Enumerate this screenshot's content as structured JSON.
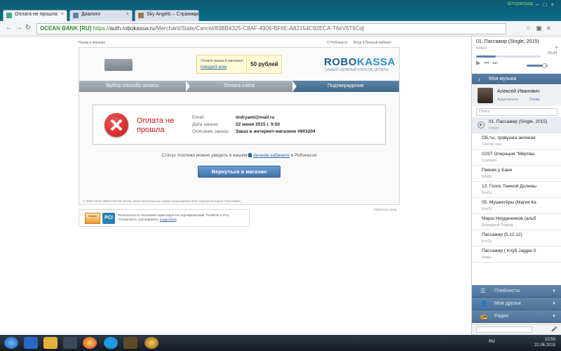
{
  "browser": {
    "tabs": [
      {
        "label": "Оплата не прошла"
      },
      {
        "label": "Диалоги"
      },
      {
        "label": "Sky Angels – Страница"
      }
    ],
    "top_brand": "Штормград",
    "ev_label": "OCEAN BANK [RU]",
    "url_scheme": "https://",
    "url_host": "auth.robokassa.ru",
    "url_path": "/Merchant/State/Cancel/83BB4325-C8AF-4906-BF6E-A82154C92ECA-T6eV5T6Cdj"
  },
  "page": {
    "back_link": "Назад в магазин",
    "about_link": "О Робокассе",
    "cabinet_link": "Вход в Личный кабинет",
    "order_label": "Оплата заказа в магазине",
    "shop_name": "tsengard-wow",
    "amount": "50 рублей",
    "logo_a": "ROBO",
    "logo_b": "KASSA",
    "logo_tagline": "САМЫЙ УДОБНЫЙ СПОСОБ ОПЛАТЫ",
    "steps": [
      "Выбор способа оплаты",
      "Оплата счета",
      "Подтверждение"
    ],
    "error_title": "Оплата не прошла",
    "info": {
      "email_label": "Email:",
      "email": "drdryaml@mail.ru",
      "date_label": "Дата заказа:",
      "date": "22 июня 2015 г. 9:50",
      "desc_label": "Описание заказа:",
      "desc": "Заказ в интернет-магазине #903204"
    },
    "status_pre": "Статус платежа можно увидеть в вашем",
    "status_link": "личном кабинете",
    "status_post": "в Робокассе.",
    "return_button": "Вернуться в магазин",
    "copyright": "© 2003-2015 ОКЕАН БАНК (ЗАО), неисключительные права пользования ЗАО «Центр Интернет Платежей»",
    "support_link": "Обратная связь",
    "badge_thawte": "thawte",
    "badge_pci": "PCI",
    "badge_text_1": "Безопасность платежей гарантируется сертификатами THAWTE и PCI.",
    "badge_text_2": "Посмотреть сертификаты",
    "badge_link": "подробнее"
  },
  "player": {
    "title": "01. Пассажир (Single, 2015)",
    "artist": "KmiZz",
    "time": "-03:04",
    "progress": 0.3,
    "section": "Моя музыка",
    "user_name": "Алексей Иванович",
    "audio_link": "Аудиозаписи",
    "wall_link": "Стена",
    "search_placeholder": "Поиск",
    "tracks": [
      {
        "title": "01. Пассажир (Single, 2015)",
        "artist": "KmiZz"
      },
      {
        "title": "Ой,ты, травушка зеленая",
        "artist": "Сектор Газа"
      },
      {
        "title": "(OST Операция \"Мёртвы",
        "artist": "Cyanised"
      },
      {
        "title": "Пикник у Бани",
        "artist": "KmiZz"
      },
      {
        "title": "13. Голос Темной Долины",
        "artist": "KmiZz"
      },
      {
        "title": "05. Мушкетёры (Магия Ка",
        "artist": "KmiZz"
      },
      {
        "title": "Марш Неудачников (альб",
        "artist": "Бригадный Подряд"
      },
      {
        "title": "Пассажир (5.12.12)",
        "artist": "KmiZz"
      },
      {
        "title": "Пассажир ( Клуб Jagger 0",
        "artist": "Кимзь"
      }
    ],
    "nav": [
      "Плейлисты",
      "Мои друзья",
      "Радио"
    ]
  },
  "taskbar": {
    "lang": "RU",
    "time": "10:50",
    "date": "22.06.2015"
  }
}
